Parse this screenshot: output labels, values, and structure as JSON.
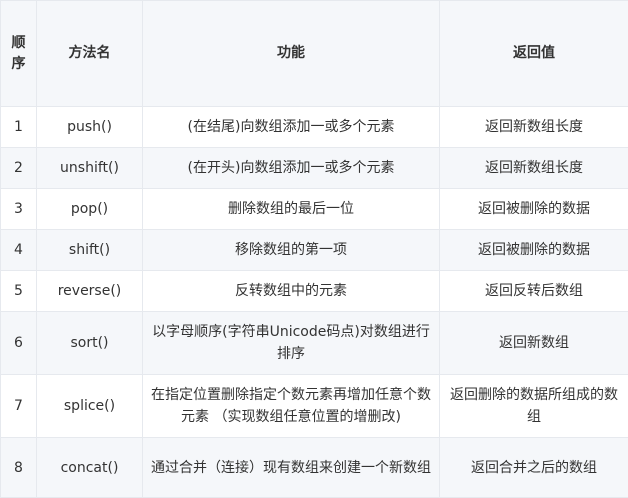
{
  "headers": {
    "order": "顺序",
    "method": "方法名",
    "function": "功能",
    "returns": "返回值"
  },
  "rows": [
    {
      "order": "1",
      "method": "push()",
      "function": "(在结尾)向数组添加一或多个元素",
      "returns": "返回新数组长度"
    },
    {
      "order": "2",
      "method": "unshift()",
      "function": "(在开头)向数组添加一或多个元素",
      "returns": "返回新数组长度"
    },
    {
      "order": "3",
      "method": "pop()",
      "function": "删除数组的最后一位",
      "returns": "返回被删除的数据"
    },
    {
      "order": "4",
      "method": "shift()",
      "function": "移除数组的第一项",
      "returns": "返回被删除的数据"
    },
    {
      "order": "5",
      "method": "reverse()",
      "function": "反转数组中的元素",
      "returns": "返回反转后数组"
    },
    {
      "order": "6",
      "method": "sort()",
      "function": "以字母顺序(字符串Unicode码点)对数组进行排序",
      "returns": "返回新数组"
    },
    {
      "order": "7",
      "method": "splice()",
      "function": "在指定位置删除指定个数元素再增加任意个数元素 （实现数组任意位置的增删改)",
      "returns": "返回删除的数据所组成的数组"
    },
    {
      "order": "8",
      "method": "concat()",
      "function": "通过合并（连接）现有数组来创建一个新数组",
      "returns": "返回合并之后的数组"
    }
  ]
}
